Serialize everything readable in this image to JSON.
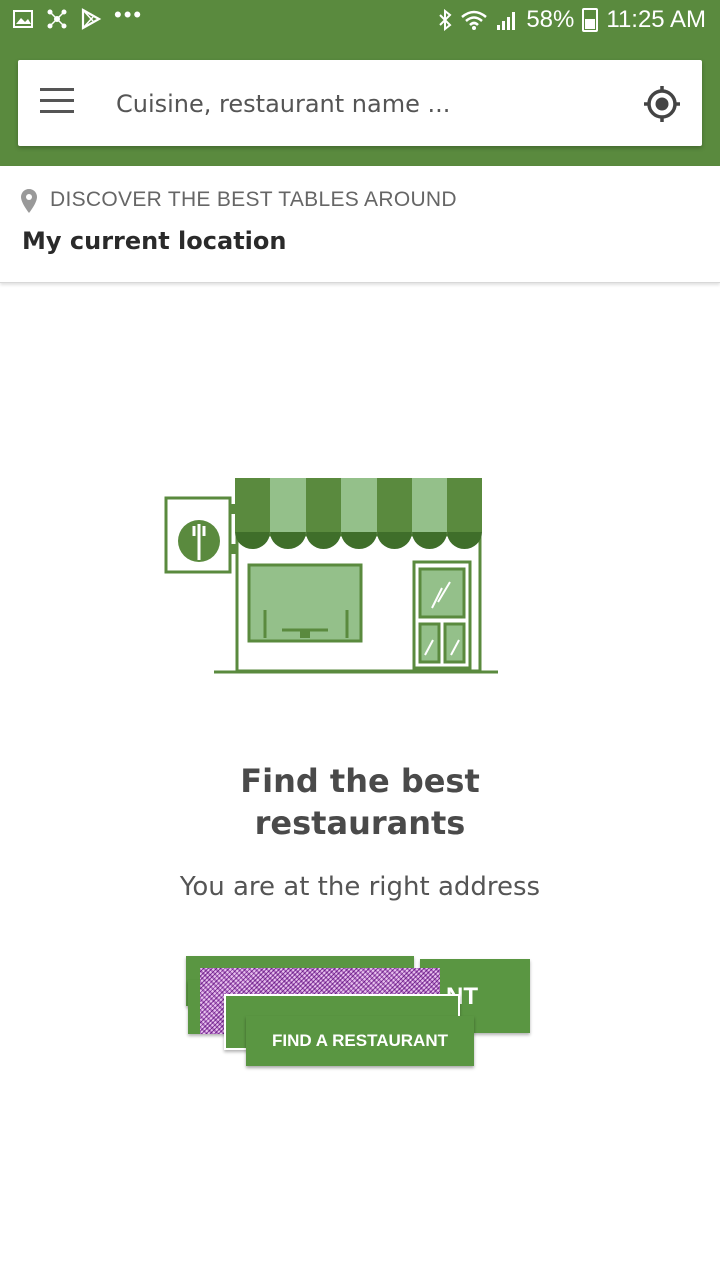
{
  "status_bar": {
    "battery": "58%",
    "time": "11:25 AM",
    "overflow": "•••",
    "icons": [
      "image-icon",
      "network-icon",
      "play-store-icon",
      "bluetooth-icon",
      "wifi-icon",
      "signal-icon",
      "battery-icon"
    ]
  },
  "search": {
    "placeholder": "Cuisine, restaurant name ..."
  },
  "location": {
    "label": "DISCOVER THE BEST TABLES AROUND",
    "value": "My current location"
  },
  "empty_state": {
    "title_line1": "Find the best",
    "title_line2": "restaurants",
    "subtitle": "You are at the right address",
    "ghost_text": "NT",
    "cta_label": "FIND A RESTAURANT"
  },
  "colors": {
    "brand": "#5a8a3e",
    "button": "#5a9642",
    "light_green": "#94c08a"
  }
}
